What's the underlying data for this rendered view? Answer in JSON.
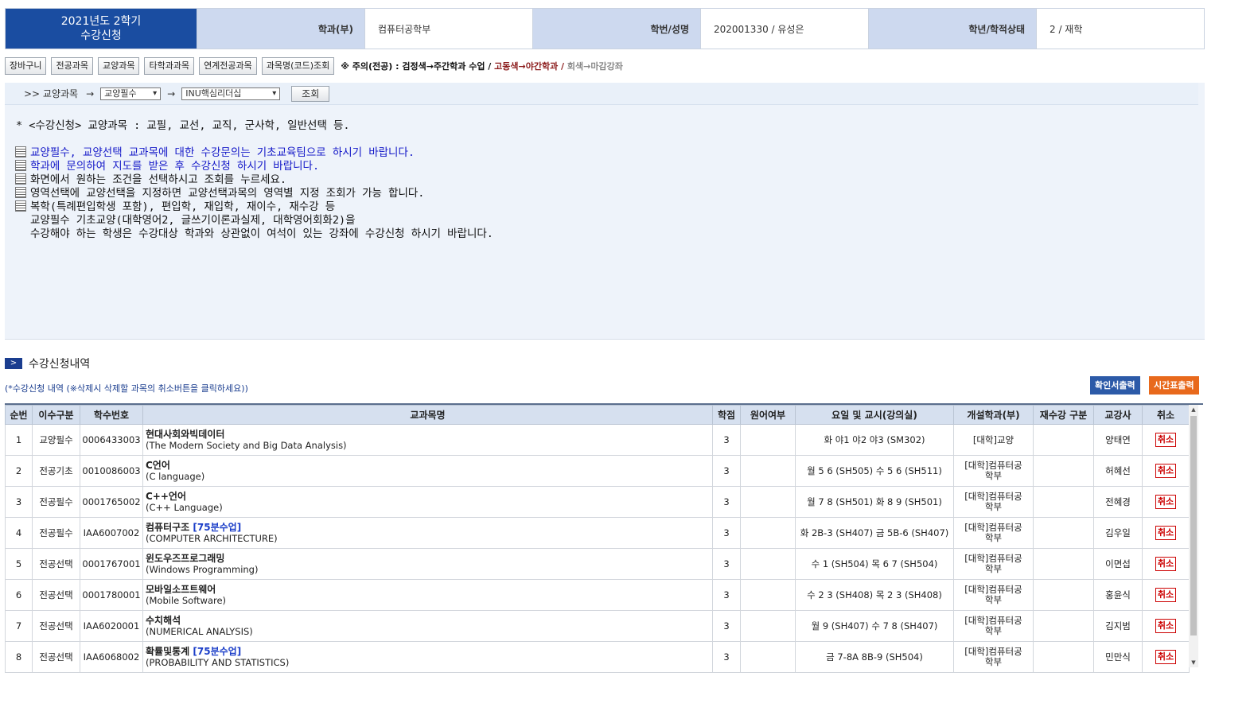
{
  "header": {
    "term_line1": "2021년도 2학기",
    "term_line2": "수강신청",
    "dept_label": "학과(부)",
    "dept_value": "컴퓨터공학부",
    "id_label": "학번/성명",
    "id_value": "202001330 / 유성은",
    "status_label": "학년/학적상태",
    "status_value": "2 / 재학",
    "brand_color": "#1a4da1"
  },
  "toolbar": {
    "buttons": [
      "장바구니",
      "전공과목",
      "교양과목",
      "타학과과목",
      "연계전공과목",
      "과목명(코드)조회"
    ],
    "notice_1": "※ 주의(전공) : 검정색→주간학과 수업 /",
    "notice_2": "고동색→야간학과 /",
    "notice_3": "회색→마감강좌"
  },
  "filter": {
    "prefix": ">> 교양과목",
    "arrow": "→",
    "select1": "교양필수",
    "select2": "INU핵심리더십",
    "search_button": "조회"
  },
  "info": {
    "line0": "* <수강신청> 교양과목 : 교필, 교선, 교직, 군사학, 일반선택 등.",
    "line1": "교양필수, 교양선택 교과목에 대한 수강문의는 기초교육팀으로 하시기 바랍니다.",
    "line2": "학과에 문의하여 지도를 받은 후 수강신청 하시기 바랍니다.",
    "line3": "화면에서 원하는 조건을 선택하시고 조회를 누르세요.",
    "line4": "영역선택에 교양선택을 지정하면 교양선택과목의 영역별 지정 조회가 가능 합니다.",
    "line5": "복학(특례편입학생 포함), 편입학, 재입학, 재이수, 재수강 등",
    "line6": "교양필수 기초교양(대학영어2, 글쓰기이론과실제, 대학영어회화2)을",
    "line7": "수강해야 하는 학생은 수강대상 학과와 상관없이 여석이 있는 강좌에 수강신청 하시기 바랍니다."
  },
  "section": {
    "title": "수강신청내역",
    "subnote": "(*수강신청 내역 (※삭제시 삭제할 과목의 취소버튼을 클릭하세요))",
    "confirm_button": "확인서출력",
    "timetable_button": "시간표출력",
    "confirm_color": "#2c5aa8",
    "timetable_color": "#e8691c"
  },
  "table": {
    "headers": [
      "순번",
      "이수구분",
      "학수번호",
      "교과목명",
      "학점",
      "원어여부",
      "요일 및 교시(강의실)",
      "개설학과(부)",
      "재수강 구분",
      "교강사",
      "취소"
    ],
    "cancel_label": "취소",
    "rows": [
      {
        "no": "1",
        "type": "교양필수",
        "code": "0006433003",
        "name": "현대사회와빅데이터",
        "tag": "",
        "name_en": "(The Modern Society and Big Data Analysis)",
        "credit": "3",
        "lang": "",
        "time": "화 야1 야2 야3 (SM302)",
        "dept1": "[대학]교양",
        "dept2": "",
        "retake": "",
        "prof": "양태연"
      },
      {
        "no": "2",
        "type": "전공기초",
        "code": "0010086003",
        "name": "C언어",
        "tag": "",
        "name_en": "(C language)",
        "credit": "3",
        "lang": "",
        "time": "월 5 6 (SH505) 수 5 6 (SH511)",
        "dept1": "[대학]컴퓨터공",
        "dept2": "학부",
        "retake": "",
        "prof": "허혜선"
      },
      {
        "no": "3",
        "type": "전공필수",
        "code": "0001765002",
        "name": "C++언어",
        "tag": "",
        "name_en": "(C++ Language)",
        "credit": "3",
        "lang": "",
        "time": "월 7 8 (SH501) 화 8 9 (SH501)",
        "dept1": "[대학]컴퓨터공",
        "dept2": "학부",
        "retake": "",
        "prof": "전혜경"
      },
      {
        "no": "4",
        "type": "전공필수",
        "code": "IAA6007002",
        "name": "컴퓨터구조",
        "tag": "[75분수업]",
        "name_en": "(COMPUTER ARCHITECTURE)",
        "credit": "3",
        "lang": "",
        "time": "화 2B-3 (SH407) 금 5B-6 (SH407)",
        "dept1": "[대학]컴퓨터공",
        "dept2": "학부",
        "retake": "",
        "prof": "김우일"
      },
      {
        "no": "5",
        "type": "전공선택",
        "code": "0001767001",
        "name": "윈도우즈프로그래밍",
        "tag": "",
        "name_en": "(Windows Programming)",
        "credit": "3",
        "lang": "",
        "time": "수 1 (SH504) 목 6 7 (SH504)",
        "dept1": "[대학]컴퓨터공",
        "dept2": "학부",
        "retake": "",
        "prof": "이면섭"
      },
      {
        "no": "6",
        "type": "전공선택",
        "code": "0001780001",
        "name": "모바일소프트웨어",
        "tag": "",
        "name_en": "(Mobile Software)",
        "credit": "3",
        "lang": "",
        "time": "수 2 3 (SH408) 목 2 3 (SH408)",
        "dept1": "[대학]컴퓨터공",
        "dept2": "학부",
        "retake": "",
        "prof": "홍윤식"
      },
      {
        "no": "7",
        "type": "전공선택",
        "code": "IAA6020001",
        "name": "수치해석",
        "tag": "",
        "name_en": "(NUMERICAL ANALYSIS)",
        "credit": "3",
        "lang": "",
        "time": "월 9 (SH407) 수 7 8 (SH407)",
        "dept1": "[대학]컴퓨터공",
        "dept2": "학부",
        "retake": "",
        "prof": "김지범"
      },
      {
        "no": "8",
        "type": "전공선택",
        "code": "IAA6068002",
        "name": "확률및통계",
        "tag": "[75분수업]",
        "name_en": "(PROBABILITY AND STATISTICS)",
        "credit": "3",
        "lang": "",
        "time": "금 7-8A 8B-9 (SH504)",
        "dept1": "[대학]컴퓨터공",
        "dept2": "학부",
        "retake": "",
        "prof": "민만식"
      }
    ]
  }
}
